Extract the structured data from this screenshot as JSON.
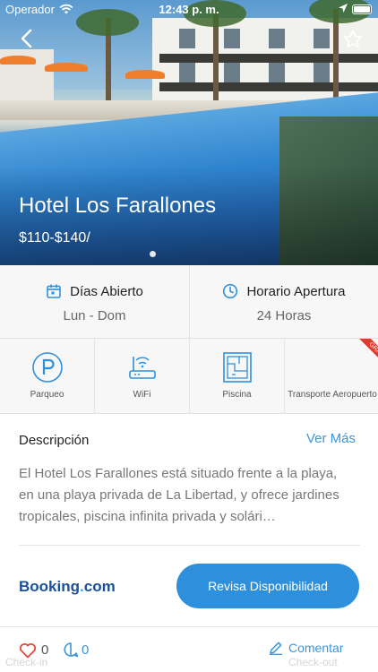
{
  "status_bar": {
    "carrier": "Operador",
    "time": "12:43 p. m."
  },
  "hotel": {
    "name": "Hotel Los Farallones",
    "price": "$110-$140/"
  },
  "info": {
    "days_label": "Días Abierto",
    "days_value": "Lun - Dom",
    "hours_label": "Horario Apertura",
    "hours_value": "24 Horas"
  },
  "amenities": [
    {
      "label": "Parqueo",
      "icon": "parking-icon"
    },
    {
      "label": "WiFi",
      "icon": "wifi-router-icon"
    },
    {
      "label": "Piscina",
      "icon": "pool-icon"
    },
    {
      "label": "Transporte Aeropuerto",
      "icon": "airport-transport-icon"
    }
  ],
  "badge": "GRATIS",
  "description": {
    "title": "Descripción",
    "more_link": "Ver Más",
    "text": "El Hotel Los Farallones está situado frente a la playa, en una playa privada de La Libertad, y ofrece jardines tropicales, piscina infinita privada y solári…"
  },
  "booking": {
    "brand_main": "Booking",
    "brand_dot": ".",
    "brand_tld": "com",
    "cta": "Revisa Disponibilidad"
  },
  "bottom_bar": {
    "likes": "0",
    "comments": "0",
    "comment_button": "Comentar",
    "ghost_left": "Check-in",
    "ghost_right": "Check-out"
  },
  "colors": {
    "accent": "#2e90dd",
    "link": "#3b95d8",
    "heart": "#e24a3b",
    "badge": "#e13a2f"
  }
}
